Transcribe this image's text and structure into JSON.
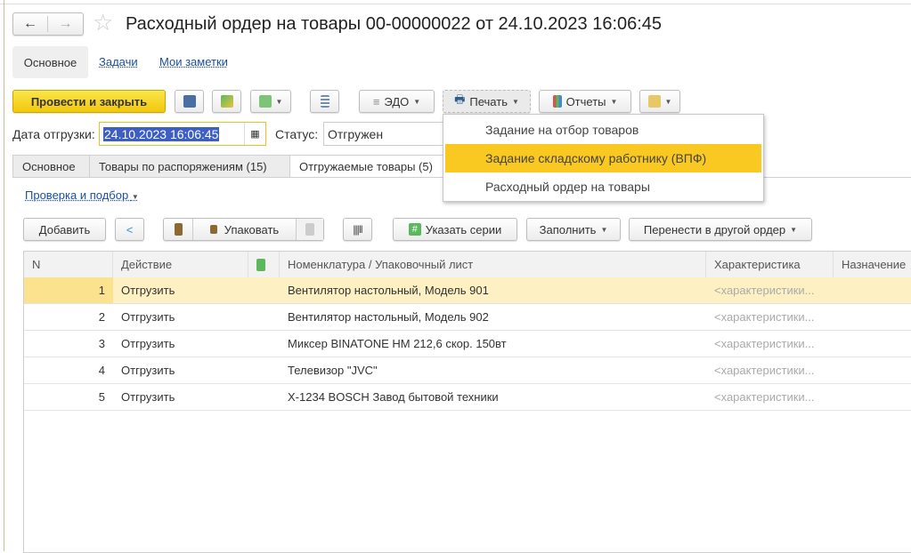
{
  "window": {
    "title": "Расходный ордер на товары 00-00000022 от 24.10.2023 16:06:45"
  },
  "nav_tabs": [
    {
      "label": "Основное"
    },
    {
      "label": "Задачи"
    },
    {
      "label": "Мои заметки"
    }
  ],
  "toolbar": {
    "post_close": "Провести и закрыть",
    "edo": "ЭДО",
    "print": "Печать",
    "reports": "Отчеты"
  },
  "form": {
    "ship_date_label": "Дата отгрузки:",
    "ship_date": "24.10.2023 16:06:45",
    "status_label": "Статус:",
    "status": "Отгружен"
  },
  "tabs": [
    {
      "label": "Основное"
    },
    {
      "label": "Товары по распоряжениям (15)"
    },
    {
      "label": "Отгружаемые товары (5)"
    }
  ],
  "check_link": "Проверка и подбор",
  "table_toolbar": {
    "add": "Добавить",
    "pack": "Упаковать",
    "series": "Указать серии",
    "fill": "Заполнить",
    "move": "Перенести в другой ордер"
  },
  "table": {
    "columns": [
      "N",
      "Действие",
      "",
      "Номенклатура / Упаковочный лист",
      "Характеристика",
      "Назначение"
    ],
    "rows": [
      {
        "n": "1",
        "action": "Отгрузить",
        "item": "Вентилятор настольный, Модель 901",
        "char": "<характеристики..."
      },
      {
        "n": "2",
        "action": "Отгрузить",
        "item": "Вентилятор настольный, Модель 902",
        "char": "<характеристики..."
      },
      {
        "n": "3",
        "action": "Отгрузить",
        "item": "Миксер BINATONE HM 212,6 скор. 150вт",
        "char": "<характеристики..."
      },
      {
        "n": "4",
        "action": "Отгрузить",
        "item": "Телевизор \"JVC\"",
        "char": "<характеристики..."
      },
      {
        "n": "5",
        "action": "Отгрузить",
        "item": "X-1234 BOSCH Завод бытовой техники",
        "char": "<характеристики..."
      }
    ]
  },
  "print_menu": {
    "items": [
      {
        "label": "Задание на отбор товаров"
      },
      {
        "label": "Задание складскому работнику (ВПФ)"
      },
      {
        "label": "Расходный ордер на товары"
      }
    ],
    "highlighted": 1
  },
  "colors": {
    "accent": "#f9c922",
    "selected_row": "#fdf1c4",
    "link": "#1c4fa0"
  }
}
